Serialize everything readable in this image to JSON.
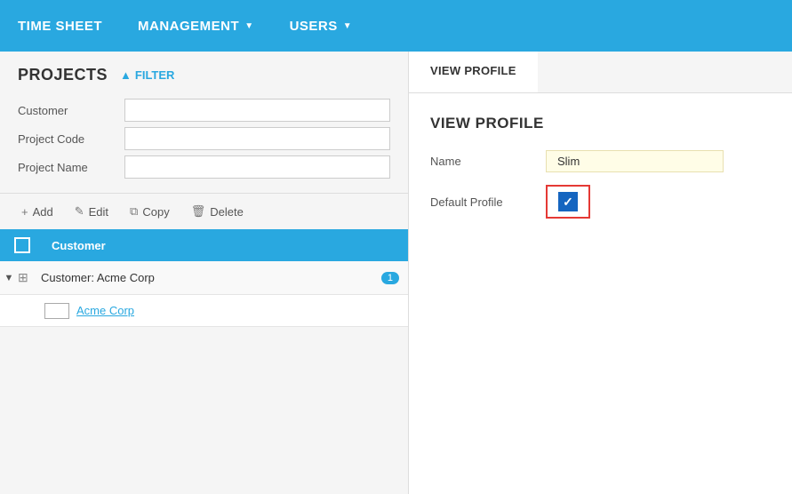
{
  "nav": {
    "items": [
      {
        "id": "timesheet",
        "label": "TIME SHEET",
        "hasDropdown": false
      },
      {
        "id": "management",
        "label": "MANAGEMENT",
        "hasDropdown": true
      },
      {
        "id": "users",
        "label": "USERS",
        "hasDropdown": true
      }
    ]
  },
  "leftPanel": {
    "title": "PROJECTS",
    "filter": {
      "label": "FILTER",
      "chevron": "▲",
      "fields": [
        {
          "id": "customer",
          "label": "Customer",
          "value": ""
        },
        {
          "id": "project_code",
          "label": "Project Code",
          "value": ""
        },
        {
          "id": "project_name",
          "label": "Project Name",
          "value": ""
        }
      ]
    },
    "toolbar": {
      "add": "+ Add",
      "edit": "Edit",
      "copy": "Copy",
      "delete": "Delete"
    },
    "table": {
      "header": "Customer",
      "group": {
        "label": "Customer: Acme Corp",
        "count": 1
      },
      "row": {
        "name": "Acme Corp"
      }
    }
  },
  "rightPanel": {
    "tab": "VIEW PROFILE",
    "title": "VIEW PROFILE",
    "fields": [
      {
        "id": "name",
        "label": "Name",
        "value": "Slim"
      },
      {
        "id": "default_profile",
        "label": "Default Profile",
        "checked": true
      }
    ]
  }
}
